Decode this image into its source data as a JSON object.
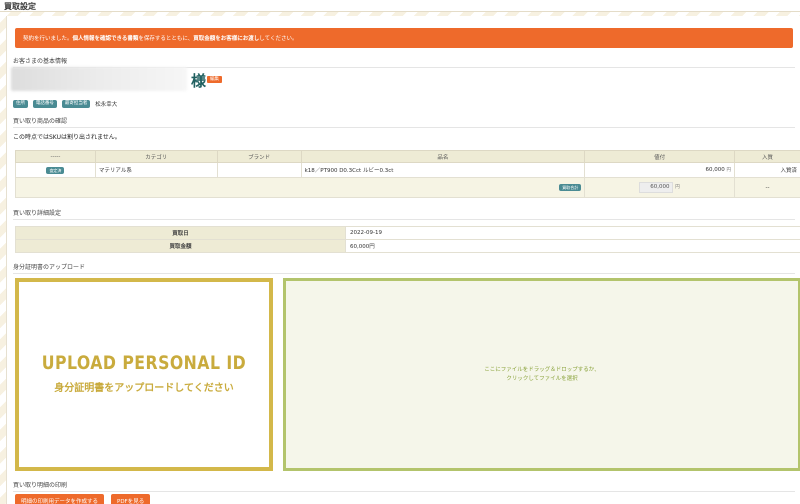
{
  "window": {
    "title": "買取設定"
  },
  "alert": {
    "text_pre": "契約を行いました。",
    "text_bold1": "個人情報を確認できる書類",
    "text_mid": "を保存するとともに、",
    "text_bold2": "買取金額をお客様にお渡し",
    "text_post": "してください。"
  },
  "customer": {
    "section_title": "お客さまの基本情報",
    "honorific": "様",
    "edit_label": "編集",
    "tags": [
      "住所",
      "電話番号",
      "最寄担当者"
    ],
    "staff_name": "松永幸大"
  },
  "items": {
    "section_title": "買い取り商品の確認",
    "notice": "この時点ではSKUは割り出されません。",
    "columns": [
      "-----",
      "カテゴリ",
      "ブランド",
      "品名",
      "値付",
      "入質"
    ],
    "rows": [
      {
        "badge": "査定済",
        "category": "マテリアル系",
        "brand": "",
        "name": "k18／PT900 D0.3Cct ルビー0.3ct",
        "price": "60,000",
        "price_unit": "円",
        "status": "入質済"
      }
    ],
    "footer": {
      "badge": "買取合計",
      "total": "60,000",
      "unit": "円",
      "status": "--"
    }
  },
  "details": {
    "section_title": "買い取り詳細設定",
    "rows": [
      {
        "label": "買取日",
        "value": "2022-09-19"
      },
      {
        "label": "買取金額",
        "value": "60,000円"
      }
    ]
  },
  "upload": {
    "section_title": "身分証明書のアップロード",
    "id_title": "UPLOAD PERSONAL ID",
    "id_subtitle": "身分証明書をアップロードしてください",
    "drop_line1": "ここにファイルをドラッグ＆ドロップするか、",
    "drop_line2": "クリックしてファイルを選択"
  },
  "print": {
    "section_title": "買い取り明細の印刷",
    "create_label": "明細の印刷用データを作成する",
    "pdf_label": "PDFを見る"
  },
  "colors": {
    "accent": "#ee6a2b",
    "teal": "#4a8b93",
    "gold": "#d3b84a",
    "olive": "#b3c46c"
  }
}
